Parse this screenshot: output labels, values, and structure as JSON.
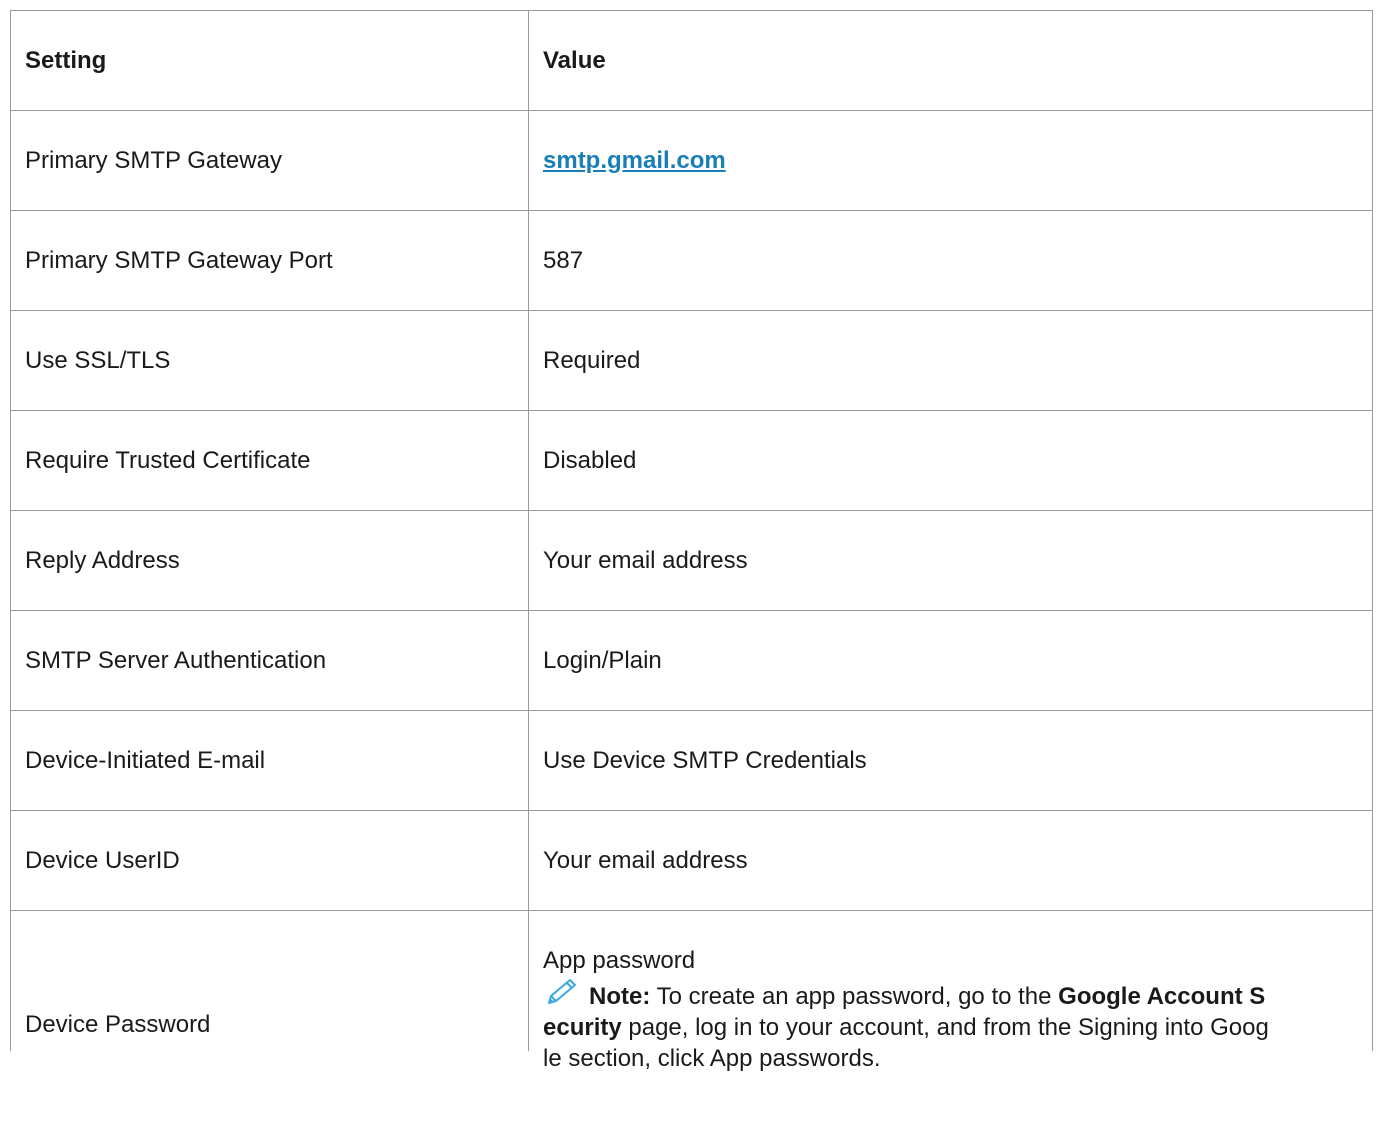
{
  "table": {
    "headers": {
      "setting": "Setting",
      "value": "Value"
    },
    "rows": [
      {
        "setting": "Primary SMTP Gateway",
        "value": "smtp.gmail.com"
      },
      {
        "setting": "Primary SMTP Gateway Port",
        "value": "587"
      },
      {
        "setting": "Use SSL/TLS",
        "value": "Required"
      },
      {
        "setting": "Require Trusted Certificate",
        "value": "Disabled"
      },
      {
        "setting": "Reply Address",
        "value": "Your email address"
      },
      {
        "setting": "SMTP Server Authentication",
        "value": "Login/Plain"
      },
      {
        "setting": "Device-Initiated E-mail",
        "value": "Use Device SMTP Credentials"
      },
      {
        "setting": "Device UserID",
        "value": "Your email address"
      },
      {
        "setting": "Device Password",
        "value": "App password"
      }
    ],
    "note": {
      "icon": "pencil-icon",
      "label": "Note:",
      "text_before": " To create an app password, go to the ",
      "bold_a": "Google Account S",
      "bold_b": "ecurity",
      "text_mid": " page, log in to your account, and from the Signing into Goog",
      "text_end": "le section, click App passwords."
    }
  },
  "colors": {
    "link": "#1a7fb8",
    "border": "#9a9a9a",
    "icon": "#3ca9e0"
  }
}
